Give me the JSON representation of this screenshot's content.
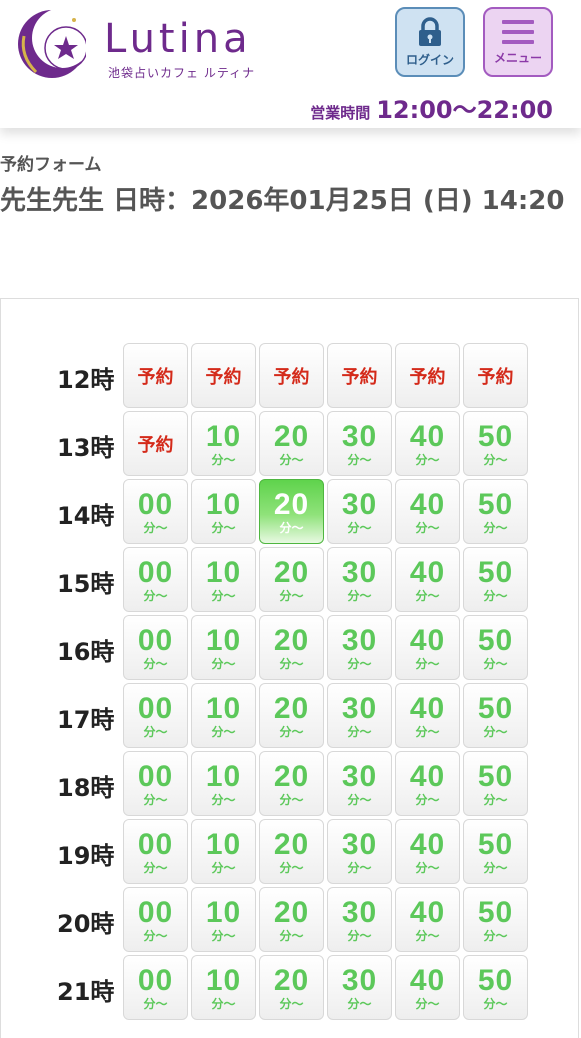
{
  "header": {
    "brand": "Lutina",
    "brand_sub": "池袋占いカフェ ルティナ",
    "login_label": "ログイン",
    "menu_label": "メニュー",
    "hours_label": "営業時間",
    "hours_value": "12:00〜22:00",
    "icons": {
      "login": "lock-icon",
      "menu": "hamburger-icon",
      "logo": "moon-star-icon"
    },
    "colors": {
      "brand": "#6e2a8c",
      "login_bg": "#cfe2f2",
      "menu_bg": "#ecd4f2"
    }
  },
  "form": {
    "label": "予約フォーム",
    "datetime": "先生先生 日時：2026年01月25日 (日) 14:20"
  },
  "schedule": {
    "minute_unit": "分〜",
    "reserved_label": "予約",
    "colors": {
      "available": "#5cc85a",
      "reserved": "#d42a1a",
      "selected": "#5fd34c"
    },
    "rows": [
      {
        "hour": "12時",
        "slots": [
          {
            "label": "予約",
            "state": "reserved"
          },
          {
            "label": "予約",
            "state": "reserved"
          },
          {
            "label": "予約",
            "state": "reserved"
          },
          {
            "label": "予約",
            "state": "reserved"
          },
          {
            "label": "予約",
            "state": "reserved"
          },
          {
            "label": "予約",
            "state": "reserved"
          }
        ]
      },
      {
        "hour": "13時",
        "slots": [
          {
            "label": "予約",
            "state": "reserved"
          },
          {
            "label": "10",
            "state": "available"
          },
          {
            "label": "20",
            "state": "available"
          },
          {
            "label": "30",
            "state": "available"
          },
          {
            "label": "40",
            "state": "available"
          },
          {
            "label": "50",
            "state": "available"
          }
        ]
      },
      {
        "hour": "14時",
        "slots": [
          {
            "label": "00",
            "state": "available"
          },
          {
            "label": "10",
            "state": "available"
          },
          {
            "label": "20",
            "state": "selected"
          },
          {
            "label": "30",
            "state": "available"
          },
          {
            "label": "40",
            "state": "available"
          },
          {
            "label": "50",
            "state": "available"
          }
        ]
      },
      {
        "hour": "15時",
        "slots": [
          {
            "label": "00",
            "state": "available"
          },
          {
            "label": "10",
            "state": "available"
          },
          {
            "label": "20",
            "state": "available"
          },
          {
            "label": "30",
            "state": "available"
          },
          {
            "label": "40",
            "state": "available"
          },
          {
            "label": "50",
            "state": "available"
          }
        ]
      },
      {
        "hour": "16時",
        "slots": [
          {
            "label": "00",
            "state": "available"
          },
          {
            "label": "10",
            "state": "available"
          },
          {
            "label": "20",
            "state": "available"
          },
          {
            "label": "30",
            "state": "available"
          },
          {
            "label": "40",
            "state": "available"
          },
          {
            "label": "50",
            "state": "available"
          }
        ]
      },
      {
        "hour": "17時",
        "slots": [
          {
            "label": "00",
            "state": "available"
          },
          {
            "label": "10",
            "state": "available"
          },
          {
            "label": "20",
            "state": "available"
          },
          {
            "label": "30",
            "state": "available"
          },
          {
            "label": "40",
            "state": "available"
          },
          {
            "label": "50",
            "state": "available"
          }
        ]
      },
      {
        "hour": "18時",
        "slots": [
          {
            "label": "00",
            "state": "available"
          },
          {
            "label": "10",
            "state": "available"
          },
          {
            "label": "20",
            "state": "available"
          },
          {
            "label": "30",
            "state": "available"
          },
          {
            "label": "40",
            "state": "available"
          },
          {
            "label": "50",
            "state": "available"
          }
        ]
      },
      {
        "hour": "19時",
        "slots": [
          {
            "label": "00",
            "state": "available"
          },
          {
            "label": "10",
            "state": "available"
          },
          {
            "label": "20",
            "state": "available"
          },
          {
            "label": "30",
            "state": "available"
          },
          {
            "label": "40",
            "state": "available"
          },
          {
            "label": "50",
            "state": "available"
          }
        ]
      },
      {
        "hour": "20時",
        "slots": [
          {
            "label": "00",
            "state": "available"
          },
          {
            "label": "10",
            "state": "available"
          },
          {
            "label": "20",
            "state": "available"
          },
          {
            "label": "30",
            "state": "available"
          },
          {
            "label": "40",
            "state": "available"
          },
          {
            "label": "50",
            "state": "available"
          }
        ]
      },
      {
        "hour": "21時",
        "slots": [
          {
            "label": "00",
            "state": "available"
          },
          {
            "label": "10",
            "state": "available"
          },
          {
            "label": "20",
            "state": "available"
          },
          {
            "label": "30",
            "state": "available"
          },
          {
            "label": "40",
            "state": "available"
          },
          {
            "label": "50",
            "state": "available"
          }
        ]
      }
    ]
  }
}
